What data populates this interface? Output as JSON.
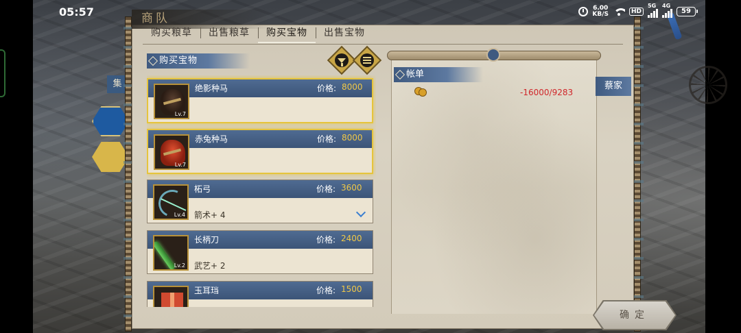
{
  "status_bar": {
    "time": "05:57",
    "net_speed": "6.00",
    "net_unit": "KB/S",
    "hd_badge": "HD",
    "signal_1": "5G",
    "signal_2": "4G",
    "battery": "59"
  },
  "window": {
    "title": "商队"
  },
  "tabs": [
    {
      "label": "购买粮草",
      "active": false
    },
    {
      "label": "出售粮草",
      "active": false
    },
    {
      "label": "购买宝物",
      "active": true
    },
    {
      "label": "出售宝物",
      "active": false
    }
  ],
  "list_section": {
    "title": "购买宝物",
    "filter_icon": "funnel-icon",
    "sort_icon": "list-icon"
  },
  "items": [
    {
      "name": "绝影种马",
      "price_label": "价格:",
      "price": "8000",
      "level": "Lv.7",
      "stat": "",
      "selected": true,
      "icon": "black-horse-icon"
    },
    {
      "name": "赤兔种马",
      "price_label": "价格:",
      "price": "8000",
      "level": "Lv.7",
      "stat": "",
      "selected": true,
      "icon": "red-horse-icon"
    },
    {
      "name": "柘弓",
      "price_label": "价格:",
      "price": "3600",
      "level": "Lv.4",
      "stat": "箭术+ 4",
      "selected": false,
      "icon": "bow-icon"
    },
    {
      "name": "长柄刀",
      "price_label": "价格:",
      "price": "2400",
      "level": "Lv.2",
      "stat": "武艺+ 2",
      "selected": false,
      "icon": "blade-icon"
    },
    {
      "name": "玉耳珰",
      "price_label": "价格:",
      "price": "1500",
      "level": "",
      "stat": "",
      "selected": false,
      "icon": "jade-earring-icon"
    }
  ],
  "ledger": {
    "title": "帐单",
    "coin_icon": "coin-icon",
    "change": "-16000",
    "separator": "/",
    "total": "9283"
  },
  "side_tab": {
    "label": "蔡家"
  },
  "background": {
    "ji_label": "集"
  },
  "confirm": {
    "label": "确定"
  },
  "colors": {
    "accent_blue": "#3f5a80",
    "price_gold": "#f0c848",
    "selected_border": "#e6c43c",
    "negative_red": "#d0262a"
  }
}
